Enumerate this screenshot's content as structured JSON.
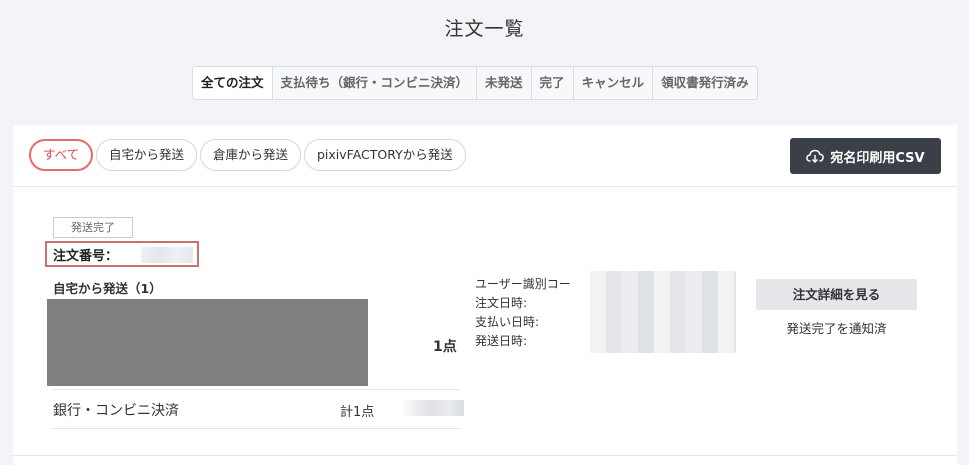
{
  "page": {
    "title": "注文一覧"
  },
  "tabs": [
    {
      "label": "全ての注文",
      "active": true
    },
    {
      "label": "支払待ち（銀行・コンビニ決済）",
      "active": false
    },
    {
      "label": "未発送",
      "active": false
    },
    {
      "label": "完了",
      "active": false
    },
    {
      "label": "キャンセル",
      "active": false
    },
    {
      "label": "領収書発行済み",
      "active": false
    }
  ],
  "filters": [
    {
      "label": "すべて",
      "active": true
    },
    {
      "label": "自宅から発送",
      "active": false
    },
    {
      "label": "倉庫から発送",
      "active": false
    },
    {
      "label": "pixivFACTORYから発送",
      "active": false
    }
  ],
  "csv_button": {
    "label": "宛名印刷用CSV",
    "icon": "cloud-download-icon"
  },
  "order": {
    "status": "発送完了",
    "number_label": "注文番号：",
    "shipping_method": "自宅から発送（1）",
    "quantity": "1点",
    "payment_method": "銀行・コンビニ決済",
    "total_count": "計1点",
    "meta_labels": [
      "ユーザー識別コー",
      "注文日時:",
      "支払い日時:",
      "発送日時:"
    ],
    "detail_button": "注文詳細を見る",
    "notified_text": "発送完了を通知済"
  },
  "colors": {
    "accent": "#e0474c",
    "dark_button": "#3b4048",
    "background": "#f2f4f7"
  }
}
